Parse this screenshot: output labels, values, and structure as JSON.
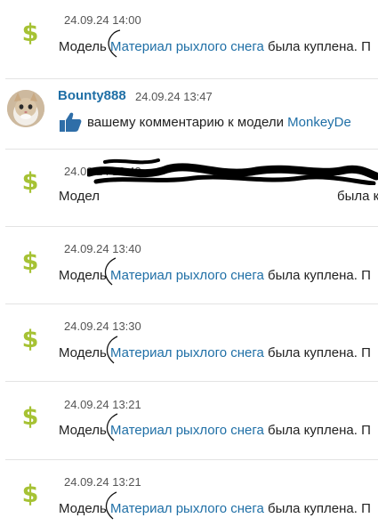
{
  "feed": {
    "items": [
      {
        "icon": "dollar-icon",
        "timestamp": "24.09.24 14:00",
        "text_prefix": "Модель",
        "link": "Материал рыхлого снега",
        "text_suffix": "была куплена. П"
      },
      {
        "icon": "avatar",
        "user": "Bounty888",
        "timestamp": "24.09.24 13:47",
        "action_icon": "thumbs-up-icon",
        "text": "вашему комментарию к модели",
        "link": "MonkeyDe"
      },
      {
        "icon": "dollar-icon",
        "timestamp": "24.09.24 13:43",
        "text_prefix": "Модел",
        "text_suffix": "была к",
        "redacted": true
      },
      {
        "icon": "dollar-icon",
        "timestamp": "24.09.24 13:40",
        "text_prefix": "Модель",
        "link": "Материал рыхлого снега",
        "text_suffix": "была куплена. П"
      },
      {
        "icon": "dollar-icon",
        "timestamp": "24.09.24 13:30",
        "text_prefix": "Модель",
        "link": "Материал рыхлого снега",
        "text_suffix": "была куплена. П"
      },
      {
        "icon": "dollar-icon",
        "timestamp": "24.09.24 13:21",
        "text_prefix": "Модель",
        "link": "Материал рыхлого снега",
        "text_suffix": "была куплена. П"
      },
      {
        "icon": "dollar-icon",
        "timestamp": "24.09.24 13:21",
        "text_prefix": "Модель",
        "link": "Материал рыхлого снега",
        "text_suffix": "была куплена. П"
      }
    ]
  },
  "colors": {
    "accent_dollar": "#a6c234",
    "link": "#1f6fa6",
    "thumb": "#2f6ea8"
  }
}
